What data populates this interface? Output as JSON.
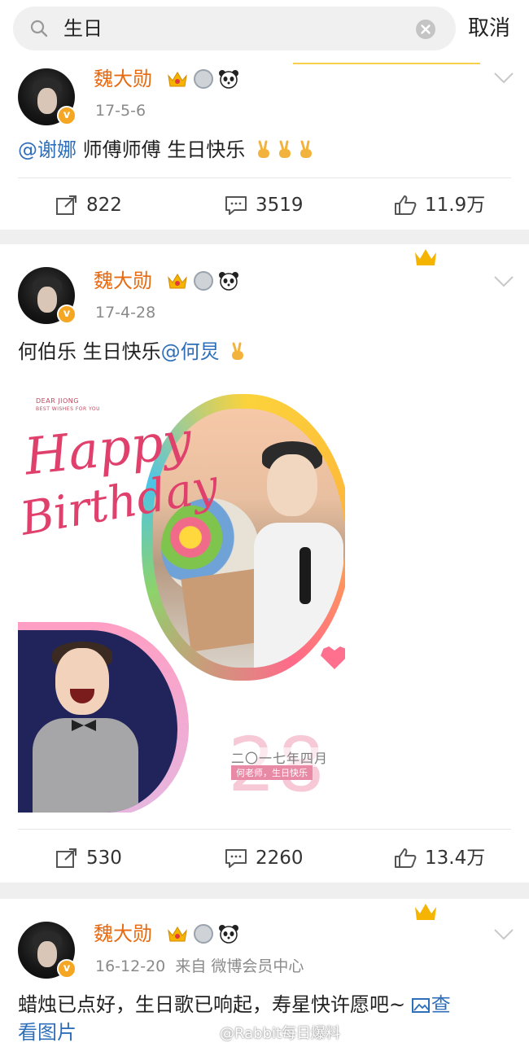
{
  "search": {
    "query": "生日",
    "cancel_label": "取消"
  },
  "posts": [
    {
      "username": "魏大勋",
      "time": "17-5-6",
      "mention": "@谢娜",
      "text": " 师傅师傅 生日快乐",
      "emojis": 3,
      "reposts": "822",
      "comments": "3519",
      "likes": "11.9万"
    },
    {
      "username": "魏大勋",
      "time": "17-4-28",
      "text": "何伯乐 生日快乐",
      "mention": "@何炅",
      "emojis": 1,
      "image": {
        "brand": "DEAR JIONG",
        "brand_sub": "BEST WISHES FOR YOU",
        "line1": "Happy",
        "line2": "Birthday",
        "big_number": "28",
        "date_text": "二〇一七年四月",
        "tag_text": "何老师，生日快乐"
      },
      "reposts": "530",
      "comments": "2260",
      "likes": "13.4万"
    },
    {
      "username": "魏大勋",
      "time": "16-12-20",
      "source": "来自 微博会员中心",
      "text_line1": "蜡烛已点好，生日歌已响起，寿星快许愿吧~ ",
      "image_link_a": "查",
      "text_line2_link": "看图片"
    }
  ],
  "watermark": "@Rabbit每日爆料",
  "colors": {
    "username": "#e86a10",
    "mention": "#2f6fba",
    "meta": "#8a8a8a"
  },
  "icons": [
    "search-icon",
    "clear-icon",
    "crown-icon",
    "medal-icon",
    "panda-icon",
    "chevron-down-icon",
    "repost-icon",
    "comment-icon",
    "like-icon",
    "victory-emoji",
    "image-icon",
    "weibo-icon"
  ]
}
